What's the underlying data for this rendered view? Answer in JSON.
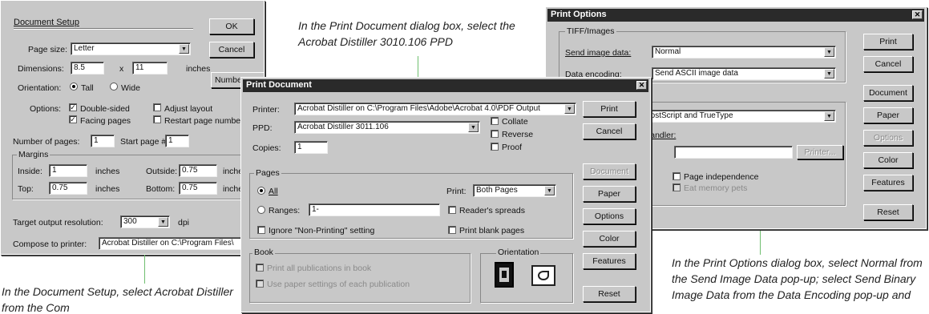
{
  "captions": {
    "top": "In the Print Document dialog box, select the Acrobat Distiller 3010.106 PPD",
    "bottom_left": "In the Document Setup, select Acrobat Distiller from the Com",
    "bottom_right": "In the Print Options dialog box, select Normal from the Send Image Data pop-up; select Send Binary Image Data from the Data Encoding pop-up and"
  },
  "document_setup": {
    "title": "Document Setup",
    "ok": "OK",
    "cancel": "Cancel",
    "numbers": "Numbers...",
    "page_size_label": "Page size:",
    "page_size_value": "Letter",
    "dimensions_label": "Dimensions:",
    "width_value": "8.5",
    "times": "x",
    "height_value": "11",
    "inches": "inches",
    "orientation_label": "Orientation:",
    "tall": "Tall",
    "wide": "Wide",
    "options_label": "Options:",
    "double_sided": "Double-sided",
    "facing_pages": "Facing pages",
    "adjust_layout": "Adjust layout",
    "restart_numbering": "Restart page numbering",
    "num_pages_label": "Number of pages:",
    "num_pages_value": "1",
    "start_page_label": "Start page #:",
    "start_page_value": "1",
    "margins_title": "Margins",
    "inside_label": "Inside:",
    "inside_value": "1",
    "outside_label": "Outside:",
    "outside_value": "0.75",
    "top_label": "Top:",
    "top_value": "0.75",
    "bottom_label": "Bottom:",
    "bottom_value": "0.75",
    "target_label": "Target output resolution:",
    "target_value": "300",
    "dpi": "dpi",
    "compose_label": "Compose to printer:",
    "compose_value": "Acrobat Distiller on C:\\Program Files\\"
  },
  "print_document": {
    "title": "Print Document",
    "printer_label": "Printer:",
    "printer_value": "Acrobat Distiller on C:\\Program Files\\Adobe\\Acrobat 4.0\\PDF Output",
    "ppd_label": "PPD:",
    "ppd_value": "Acrobat Distiller 3011.106",
    "copies_label": "Copies:",
    "copies_value": "1",
    "collate": "Collate",
    "reverse": "Reverse",
    "proof": "Proof",
    "pages_title": "Pages",
    "all": "All",
    "ranges": "Ranges:",
    "ranges_value": "1-",
    "ignore_nonprinting": "Ignore \"Non-Printing\" setting",
    "print_label": "Print:",
    "print_value": "Both Pages",
    "readers_spreads": "Reader's spreads",
    "print_blank_pages": "Print blank pages",
    "book_title": "Book",
    "book_opt1": "Print all publications in book",
    "book_opt2": "Use paper settings of each publication",
    "orientation_title": "Orientation",
    "buttons": {
      "print": "Print",
      "cancel": "Cancel",
      "document": "Document",
      "paper": "Paper",
      "options": "Options",
      "color": "Color",
      "features": "Features",
      "reset": "Reset"
    }
  },
  "print_options": {
    "title": "Print Options",
    "tiff_title": "TIFF/Images",
    "send_image_label": "Send image data:",
    "send_image_value": "Normal",
    "data_encoding_label": "Data encoding:",
    "data_encoding_value": "Send ASCII image data",
    "fonts_value": "PostScript and TrueType",
    "handler_label": "r handler:",
    "printer_btn": "Printer...",
    "page_independence": "Page independence",
    "extra_dim": "Eat memory pets",
    "buttons": {
      "print": "Print",
      "cancel": "Cancel",
      "document": "Document",
      "paper": "Paper",
      "options": "Options",
      "color": "Color",
      "features": "Features",
      "reset": "Reset"
    }
  }
}
